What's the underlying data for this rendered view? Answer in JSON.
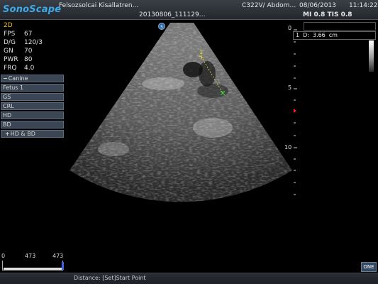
{
  "header": {
    "logo": "SonoScape",
    "hospital": "Felsozsolcai Kisallatren…",
    "study_id": "20130806_111129…",
    "probe": "C322V/ Abdom…",
    "date": "08/06/2013",
    "time": "11:14:22",
    "mi_tis": "MI 0.8 TIS 0.8"
  },
  "params": {
    "mode": "2D",
    "items": [
      {
        "label": "FPS",
        "value": "67"
      },
      {
        "label": "D/G",
        "value": "120/3"
      },
      {
        "label": "GN",
        "value": "70"
      },
      {
        "label": "PWR",
        "value": "80"
      },
      {
        "label": "FRQ",
        "value": "4.0"
      }
    ]
  },
  "menu": {
    "items": [
      {
        "prefix": "−",
        "label": "Canine"
      },
      {
        "prefix": "",
        "label": "Fetus 1"
      },
      {
        "prefix": "",
        "label": "GS"
      },
      {
        "prefix": "",
        "label": "CRL"
      },
      {
        "prefix": "",
        "label": "HD"
      },
      {
        "prefix": "",
        "label": "BD"
      },
      {
        "prefix": "+",
        "label": "HD & BD"
      }
    ]
  },
  "scan": {
    "focus_marker": "5",
    "caliper_label": "1",
    "caliper_color": "#e8e040",
    "cursor_color": "#40e040",
    "focus_color": "#ff2020"
  },
  "measure": {
    "index": "1",
    "label": "D:",
    "value": "3.66",
    "unit": "cm"
  },
  "depth_scale": {
    "labels": [
      "0",
      "5",
      "10"
    ]
  },
  "bottom": {
    "scale_left": "0",
    "scale_mid": "473",
    "scale_right": "473",
    "status": "Distance: [Set]Start Point",
    "one_button": "ONE"
  }
}
